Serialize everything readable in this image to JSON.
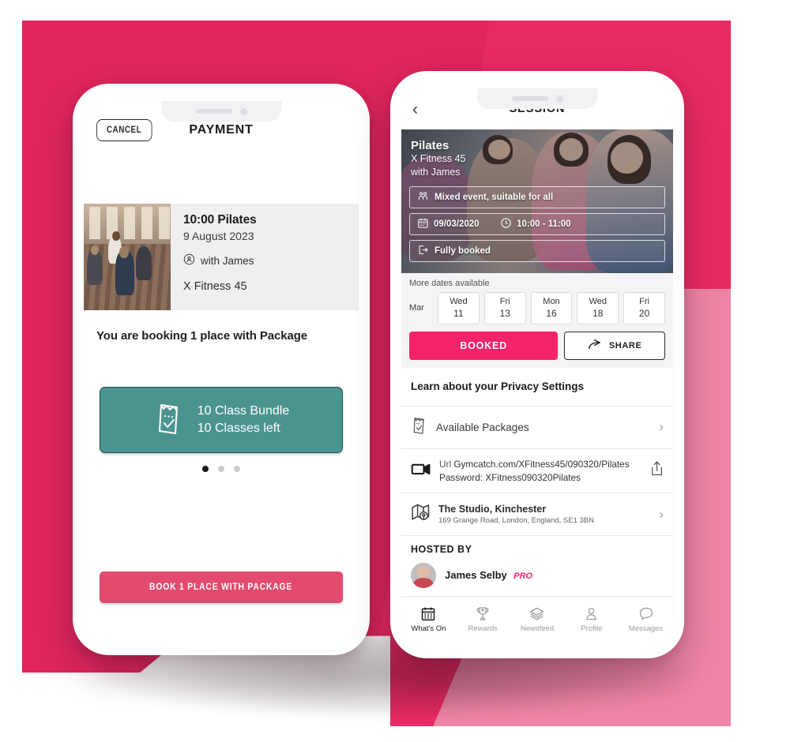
{
  "theme": {
    "brand_pink": "#E82B63",
    "button_pink": "#F5236B",
    "book_button_pink": "#E24A6E",
    "teal": "#4A9490",
    "light_pink": "#EE85A6"
  },
  "left_phone": {
    "header": {
      "cancel_label": "CANCEL",
      "title": "PAYMENT"
    },
    "class_card": {
      "title": "10:00 Pilates",
      "date": "9 August 2023",
      "instructor": "with James",
      "instructor_icon": "person-circle-icon",
      "business": "X Fitness 45",
      "photo_alt": "pilates-class-photo"
    },
    "booking_note": "You are booking 1 place with Package",
    "package_card": {
      "icon": "ticket-check-icon",
      "line1": "10 Class Bundle",
      "line2": "10 Classes left"
    },
    "carousel": {
      "total": 3,
      "active_index": 0
    },
    "cta": {
      "label": "BOOK 1 PLACE WITH PACKAGE"
    }
  },
  "right_phone": {
    "header": {
      "back_icon": "chevron-left-icon",
      "title": "SESSION"
    },
    "hero": {
      "name": "Pilates",
      "business": "X Fitness 45",
      "instructor": "with James",
      "info_boxes": [
        {
          "icon": "people-icon",
          "text": "Mixed event, suitable for all"
        },
        {
          "icon": "calendar-icon",
          "text": "09/03/2020",
          "icon2": "clock-icon",
          "text2": "10:00 - 11:00"
        },
        {
          "icon": "logout-icon",
          "text": "Fully booked"
        }
      ]
    },
    "dates": {
      "label": "More dates available",
      "month": "Mar",
      "items": [
        {
          "dow": "Wed",
          "day": "11"
        },
        {
          "dow": "Fri",
          "day": "13"
        },
        {
          "dow": "Mon",
          "day": "16"
        },
        {
          "dow": "Wed",
          "day": "18"
        },
        {
          "dow": "Fri",
          "day": "20"
        }
      ]
    },
    "actions": {
      "booked_label": "BOOKED",
      "share_label": "SHARE",
      "share_icon": "share-arrow-icon"
    },
    "privacy_row": "Learn about your Privacy Settings",
    "rows": {
      "packages": {
        "icon": "ticket-icon",
        "label": "Available Packages",
        "chevron": "chevron-right-icon"
      },
      "video": {
        "icon": "video-camera-icon",
        "url_key": "Url",
        "url_value": "Gymcatch.com/XFitness45/090320/Pilates",
        "password_line": "Password: XFitness090320Pilates",
        "action_icon": "share-upload-icon"
      },
      "location": {
        "icon": "map-pin-icon",
        "name": "The Studio, Kinchester",
        "address": "169 Grange Road, London, England, SE1 3BN",
        "chevron": "chevron-right-icon"
      }
    },
    "hosted": {
      "heading": "HOSTED BY",
      "name": "James Selby",
      "badge": "PRO",
      "avatar": "host-avatar"
    },
    "tabbar": [
      {
        "icon": "calendar-icon",
        "label": "What's On",
        "active": true
      },
      {
        "icon": "trophy-icon",
        "label": "Rewards",
        "active": false
      },
      {
        "icon": "layers-icon",
        "label": "Newsfeed",
        "active": false
      },
      {
        "icon": "person-icon",
        "label": "Profile",
        "active": false
      },
      {
        "icon": "chat-bubble-icon",
        "label": "Messages",
        "active": false
      }
    ]
  }
}
